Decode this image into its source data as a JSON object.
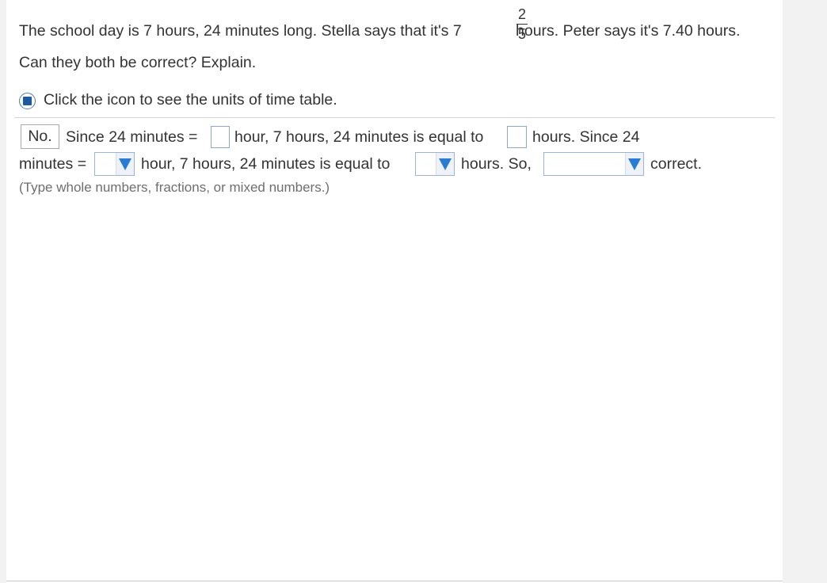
{
  "question": {
    "line1_before": "The school day is 7 hours, 24 minutes long. Stella says that it's 7",
    "fraction_numerator": "2",
    "fraction_denominator": "5",
    "line1_after": "hours. Peter says it's 7.40 hours.",
    "line2": "Can they both be correct? Explain."
  },
  "help": {
    "icon": "table-icon",
    "text": "Click the icon to see the units of time table."
  },
  "answer": {
    "selected_answer": "No.",
    "seg1": "Since 24 minutes =",
    "seg2": "hour, 7 hours, 24 minutes is equal to",
    "seg3": "hours. Since 24",
    "seg4": "minutes =",
    "seg5": "hour, 7 hours, 24 minutes is equal to",
    "seg6": "hours. So,",
    "seg7": "correct.",
    "input1_value": "",
    "input2_value": "",
    "dropdown1_value": "",
    "dropdown2_value": "",
    "dropdown3_value": "",
    "hint": "(Type whole numbers, fractions, or mixed numbers.)"
  },
  "colors": {
    "accent": "#2a7cd3",
    "text": "#333333",
    "hint": "#6e6e6e"
  }
}
